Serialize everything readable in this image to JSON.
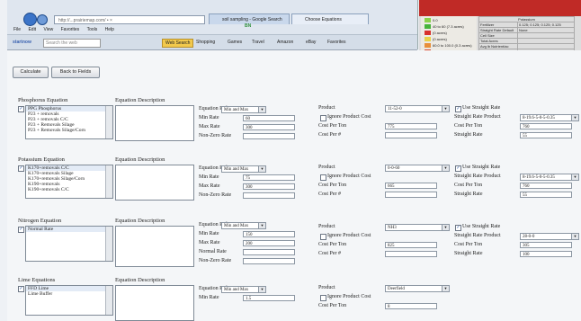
{
  "browser": {
    "address": "http://...prairiemap.com/ • ×",
    "tabs": [
      "soil sampling - Google Search",
      "Choose Equations"
    ],
    "menu": [
      "File",
      "Edit",
      "View",
      "Favorites",
      "Tools",
      "Help"
    ],
    "toolbar": {
      "search_label": "Web Search",
      "search_box": "Search the web",
      "items": [
        "Shopping",
        "Games",
        "Travel",
        "Amazon",
        "eBay",
        "Favorites"
      ],
      "brand": "startnow",
      "badge": "BN"
    }
  },
  "side_report": {
    "legend": [
      "0.0",
      "40 to 60 (7.3 acres)",
      "(0 acres)",
      "(0 acres)",
      "60.0 to 100.0 (0.3 acres)",
      "(0 acres)",
      "(0 acres)",
      "101.0 to 151.0 (1.1 acres)",
      "(0 acres)",
      "Zero Rate (0 acres)"
    ],
    "header": "Potassium",
    "rows": [
      [
        "Fertilizer",
        "0.125; 0.125; 0.125; 0.125"
      ],
      [
        "Straight Rate Default",
        "None"
      ],
      [
        "Cell Size",
        ""
      ],
      [
        "Total Acres",
        ""
      ],
      [
        "Avg lb Nutrient/ac",
        ""
      ],
      [
        "Min Release",
        ""
      ],
      [
        "Max Release",
        ""
      ],
      [
        "Avg lb/ac",
        ""
      ],
      [
        "Total lb",
        ""
      ],
      [
        "Total Product",
        ""
      ]
    ],
    "colors": [
      "#8bd14b",
      "#47b43a",
      "#d8312c",
      "#e8d24b",
      "#e88f3a",
      "#d84a2f",
      "#b53224",
      "#eec455",
      "#7c2b26",
      "#2f8f3c"
    ]
  },
  "page": {
    "buttons": [
      "Calculate",
      "Back to Fields"
    ],
    "sections": [
      {
        "id": "phosphorus",
        "title": "Phosphorus Equation",
        "desc_title": "Equation Description",
        "checked": true,
        "list": [
          "PPG Phosphorus",
          "P23 + removals",
          "P23 + removals C/C",
          "P23 + Removals Silage",
          "P23 + Removals Silage/Corn"
        ],
        "rule_label": "Equation Rule",
        "rule_value": "Min and Max",
        "fields": [
          {
            "label": "Min Rate",
            "value": "60"
          },
          {
            "label": "Max Rate",
            "value": "300"
          },
          {
            "label": "Non-Zero Rate",
            "value": ""
          }
        ],
        "product_label": "Product",
        "product_value": "11-52-0",
        "ignore_label": "Ignore Product Cost",
        "cost_ton_label": "Cost Per Ton",
        "cost_ton": "775",
        "cost_lb_label": "Cost Per #",
        "cost_lb": "",
        "use_straight_label": "Use Straight Rate",
        "use_straight_checked": true,
        "straight_product_label": "Straight Rate Product",
        "straight_product": "8-19.6-5-0-5-0.35",
        "straight_cost_label": "Cost Per Ton",
        "straight_cost": "760",
        "straight_rate_label": "Straight Rate",
        "straight_rate": "55"
      },
      {
        "id": "potassium",
        "title": "Potassium Equation",
        "desc_title": "Equation Description",
        "checked": true,
        "list": [
          "K170+removals C/C",
          "K170+removals Silage",
          "K170+removals Silage/Corn",
          "K190+removals",
          "K190+removals C/C"
        ],
        "rule_label": "Equation Rule",
        "rule_value": "Min and Max",
        "fields": [
          {
            "label": "Min Rate",
            "value": "75"
          },
          {
            "label": "Max Rate",
            "value": "300"
          },
          {
            "label": "Non-Zero Rate",
            "value": ""
          }
        ],
        "product_label": "Product",
        "product_value": "0-0-60",
        "ignore_label": "Ignore Product Cost",
        "cost_ton_label": "Cost Per Ton",
        "cost_ton": "665",
        "cost_lb_label": "Cost Per #",
        "cost_lb": "",
        "use_straight_label": "Use Straight Rate",
        "use_straight_checked": true,
        "straight_product_label": "Straight Rate Product",
        "straight_product": "8-19.6-5-0-5-0.35",
        "straight_cost_label": "Cost Per Ton",
        "straight_cost": "760",
        "straight_rate_label": "Straight Rate",
        "straight_rate": "55"
      },
      {
        "id": "nitrogen",
        "title": "Nitrogen Equation",
        "desc_title": "Equation Description",
        "checked": true,
        "list": [
          "Normal Rate"
        ],
        "rule_label": "Equation Rule",
        "rule_value": "Min and Max",
        "fields": [
          {
            "label": "Min Rate",
            "value": "150"
          },
          {
            "label": "Max Rate",
            "value": "200"
          },
          {
            "label": "Normal Rate",
            "value": ""
          },
          {
            "label": "Non-Zero Rate",
            "value": ""
          }
        ],
        "product_label": "Product",
        "product_value": "NH3",
        "ignore_label": "Ignore Product Cost",
        "cost_ton_label": "Cost Per Ton",
        "cost_ton": "825",
        "cost_lb_label": "Cost Per #",
        "cost_lb": "",
        "use_straight_label": "Use Straight Rate",
        "use_straight_checked": true,
        "straight_product_label": "Straight Rate Product",
        "straight_product": "28-0-0",
        "straight_cost_label": "Cost Per Ton",
        "straight_cost": "305",
        "straight_rate_label": "Straight Rate",
        "straight_rate": "100"
      },
      {
        "id": "lime",
        "title": "Lime Equations",
        "desc_title": "Equation Description",
        "checked": true,
        "list": [
          "FFD Lime",
          "Lime Buffer"
        ],
        "rule_label": "Equation Rule",
        "rule_value": "Min and Max",
        "fields": [
          {
            "label": "Min Rate",
            "value": "1.5"
          }
        ],
        "product_label": "Product",
        "product_value": "Deerfield",
        "ignore_label": "Ignore Product Cost",
        "cost_ton_label": "Cost Per Ton",
        "cost_ton": "8"
      }
    ]
  }
}
